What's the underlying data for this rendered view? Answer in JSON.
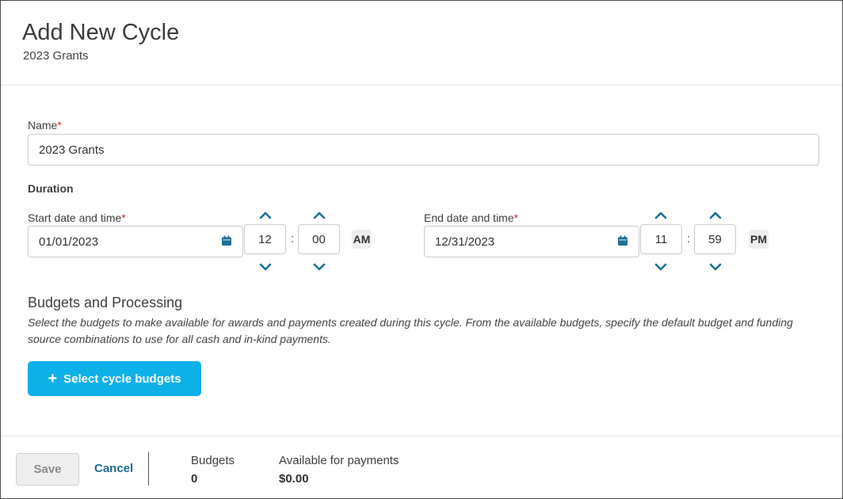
{
  "header": {
    "title": "Add New Cycle",
    "subtitle": "2023 Grants"
  },
  "form": {
    "name": {
      "label": "Name",
      "required_mark": "*",
      "value": "2023 Grants"
    },
    "duration_label": "Duration",
    "start": {
      "label": "Start date and time",
      "required_mark": "*",
      "date": "01/01/2023",
      "hour": "12",
      "minute": "00",
      "meridiem": "AM"
    },
    "end": {
      "label": "End date and time",
      "required_mark": "*",
      "date": "12/31/2023",
      "hour": "11",
      "minute": "59",
      "meridiem": "PM"
    },
    "time_separator": ":"
  },
  "budgets": {
    "title": "Budgets and Processing",
    "description": "Select the budgets to make available for awards and payments created during this cycle. From the available budgets, specify the default budget and funding source combinations to use for all cash and in-kind payments.",
    "button_label": "Select cycle budgets",
    "button_icon": "plus-icon"
  },
  "footer": {
    "save_label": "Save",
    "cancel_label": "Cancel",
    "budgets_label": "Budgets",
    "budgets_value": "0",
    "available_label": "Available for payments",
    "available_value": "$0.00"
  },
  "colors": {
    "primary": "#0eb0e8",
    "link": "#1a6a96",
    "chevron": "#1d6f96",
    "required": "#d62b2b"
  }
}
